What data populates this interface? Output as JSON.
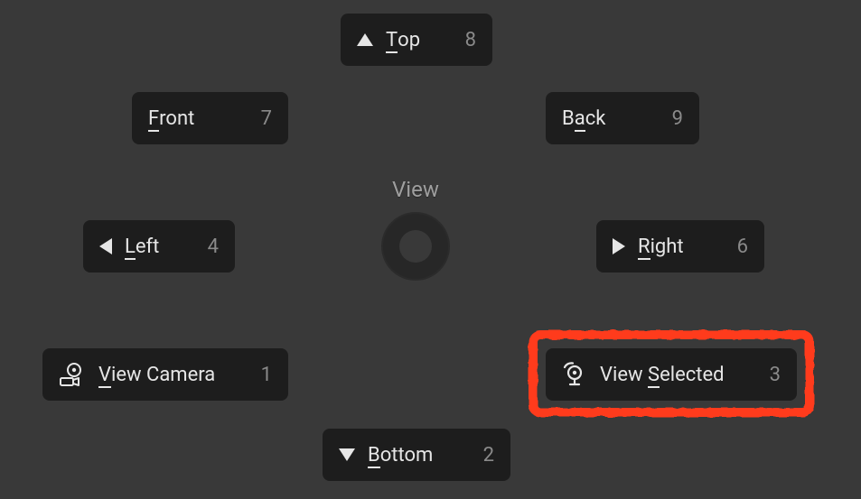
{
  "center": {
    "label": "View"
  },
  "buttons": {
    "top": {
      "label_pre": "",
      "label_u": "T",
      "label_post": "op",
      "shortcut": "8"
    },
    "front": {
      "label_pre": "",
      "label_u": "F",
      "label_post": "ront",
      "shortcut": "7"
    },
    "back": {
      "label_pre": "B",
      "label_u": "a",
      "label_post": "ck",
      "shortcut": "9"
    },
    "left": {
      "label_pre": "",
      "label_u": "L",
      "label_post": "eft",
      "shortcut": "4"
    },
    "right": {
      "label_pre": "",
      "label_u": "R",
      "label_post": "ight",
      "shortcut": "6"
    },
    "camera": {
      "label_pre": "",
      "label_u": "V",
      "label_post": "iew Camera",
      "shortcut": "1"
    },
    "selected": {
      "label_pre": "View ",
      "label_u": "S",
      "label_post": "elected",
      "shortcut": "3"
    },
    "bottom": {
      "label_pre": "",
      "label_u": "B",
      "label_post": "ottom",
      "shortcut": "2"
    }
  },
  "highlight": "selected"
}
